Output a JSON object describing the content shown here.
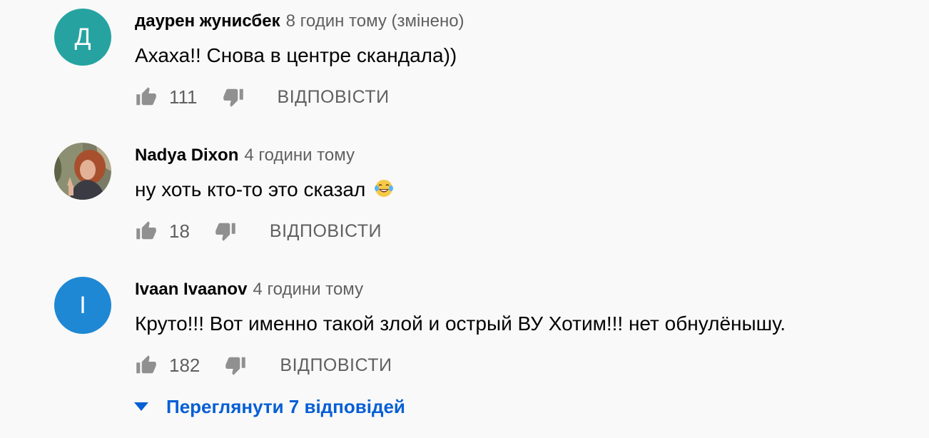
{
  "comments": [
    {
      "author": "даурен жунисбек",
      "time": "8 годин тому (змінено)",
      "avatar_letter": "Д",
      "avatar_color": "#26a3a1",
      "text": "Ахаха!! Снова в центре скандала))",
      "likes": "111",
      "reply_label": "ВІДПОВІСТИ"
    },
    {
      "author": "Nadya Dixon",
      "time": "4 години тому",
      "avatar_type": "photo",
      "text": "ну хоть кто-то это сказал",
      "emoji": "face-with-tears-of-joy",
      "likes": "18",
      "reply_label": "ВІДПОВІСТИ"
    },
    {
      "author": "Ivaan Ivaanov",
      "time": "4 години тому",
      "avatar_letter": "I",
      "avatar_color": "#1e88d4",
      "text": "Круто!!! Вот именно такой злой и острый ВУ Хотим!!! нет обнулёнышу.",
      "likes": "182",
      "reply_label": "ВІДПОВІСТИ"
    }
  ],
  "view_replies": {
    "label": "Переглянути 7 відповідей",
    "icon": "caret-down-icon"
  },
  "colors": {
    "background": "#f9f9f9",
    "link": "#065fd4",
    "secondary_text": "#606060",
    "icon": "#909090"
  }
}
